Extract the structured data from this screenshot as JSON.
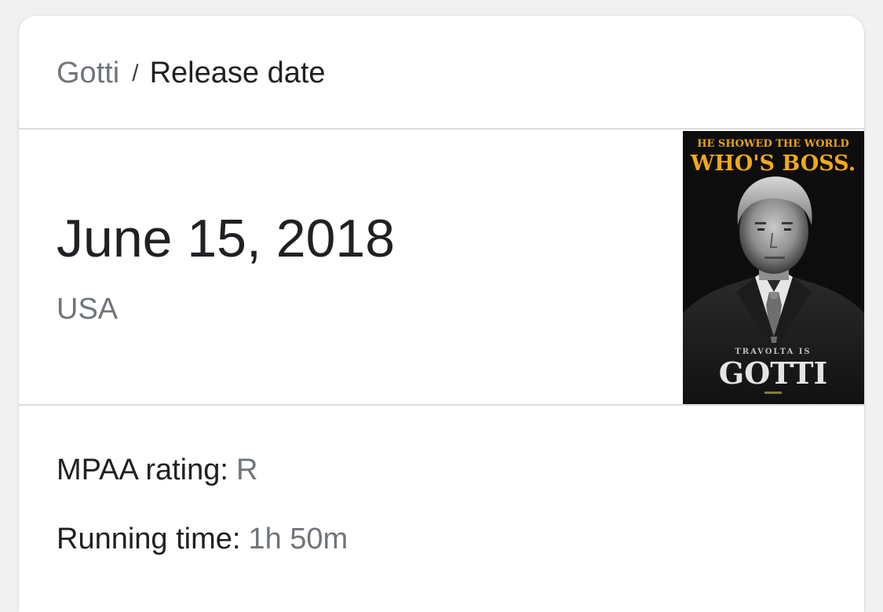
{
  "breadcrumb": {
    "parent": "Gotti",
    "separator": "/",
    "current": "Release date"
  },
  "release": {
    "date": "June 15, 2018",
    "country": "USA"
  },
  "poster": {
    "tagline_top": "HE SHOWED THE WORLD",
    "tagline_main": "WHO'S BOSS.",
    "credit": "TRAVOLTA IS",
    "title": "GOTTI",
    "icon": "movie-poster"
  },
  "details": [
    {
      "label": "MPAA rating:",
      "value": "R"
    },
    {
      "label": "Running time:",
      "value": "1h 50m"
    }
  ],
  "colors": {
    "primary_text": "#202124",
    "secondary_text": "#70757a",
    "divider": "#dadce0",
    "poster_accent": "#f0a81e"
  }
}
